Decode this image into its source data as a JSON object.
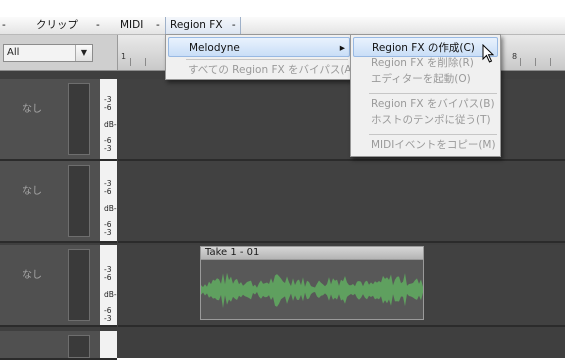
{
  "menubar": {
    "items": [
      {
        "label": "-"
      },
      {
        "label": "クリップ"
      },
      {
        "label": "-"
      },
      {
        "label": "MIDI"
      },
      {
        "label": "-"
      },
      {
        "label": "Region FX"
      },
      {
        "label": "-"
      }
    ]
  },
  "toolbar": {
    "filter_value": "All",
    "filter_arrow": "▼"
  },
  "ruler": {
    "labels": [
      "1",
      "8"
    ]
  },
  "tracks": [
    {
      "name": "なし",
      "db": [
        "-3",
        "-6",
        "dB-",
        "-6",
        "-3"
      ]
    },
    {
      "name": "なし",
      "db": [
        "-3",
        "-6",
        "dB-",
        "-6",
        "-3"
      ]
    },
    {
      "name": "なし",
      "db": [
        "-3",
        "-6",
        "dB-",
        "-6",
        "-3"
      ]
    }
  ],
  "clip": {
    "title": "Take 1 - 01",
    "waveform_color": "#5fa05f"
  },
  "region_fx_menu": {
    "items": [
      {
        "label": "Melodyne",
        "arrow": "▸"
      },
      {
        "label": "すべての Region FX をバイパス(A)"
      }
    ]
  },
  "melodyne_submenu": {
    "items": [
      {
        "label": "Region FX の作成(C)"
      },
      {
        "label": "Region FX を削除(R)"
      },
      {
        "label": "エディターを起動(O)"
      },
      {
        "label": "Region FX をバイパス(B)"
      },
      {
        "label": "ホストのテンポに従う(T)"
      },
      {
        "label": "MIDIイベントをコピー(M)"
      }
    ]
  },
  "colors": {
    "track_background": "#414141",
    "highlight": "#c9def7"
  }
}
